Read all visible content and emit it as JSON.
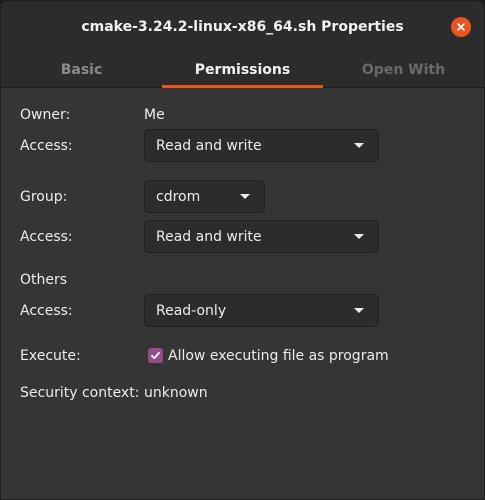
{
  "window": {
    "title": "cmake-3.24.2-linux-x86_64.sh Properties"
  },
  "tabs": [
    {
      "label": "Basic"
    },
    {
      "label": "Permissions"
    },
    {
      "label": "Open With"
    }
  ],
  "owner": {
    "label": "Owner:",
    "value": "Me",
    "access_label": "Access:",
    "access_value": "Read and write"
  },
  "group": {
    "label": "Group:",
    "value": "cdrom",
    "access_label": "Access:",
    "access_value": "Read and write"
  },
  "others": {
    "heading": "Others",
    "access_label": "Access:",
    "access_value": "Read-only"
  },
  "execute": {
    "label": "Execute:",
    "checkbox_label": "Allow executing file as program",
    "checked": true
  },
  "security": {
    "label": "Security context:",
    "value": "unknown"
  },
  "colors": {
    "accent": "#e95420",
    "checkbox": "#924d8b"
  }
}
